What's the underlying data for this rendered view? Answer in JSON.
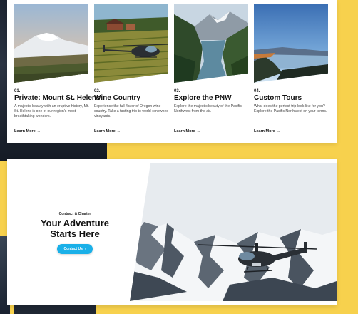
{
  "cards": [
    {
      "number": "01.",
      "title": "Private: Mount St. Helens",
      "description": "A majestic beauty with an eruptive history, Mt. St. Helens is one of our region's most breathtaking wonders.",
      "link_label": "Learn More",
      "image_icon": "mountain-image"
    },
    {
      "number": "02.",
      "title": "Wine Country",
      "description": "Experience the full flavor of Oregon wine country. Take a tasting trip to world-renowned vineyards.",
      "link_label": "Learn More",
      "image_icon": "vineyard-helicopter-image"
    },
    {
      "number": "03.",
      "title": "Explore the PNW",
      "description": "Explore the majestic beauty of the Pacific Northwest from the air.",
      "link_label": "Learn More",
      "image_icon": "river-valley-image"
    },
    {
      "number": "04.",
      "title": "Custom Tours",
      "description": "What does the perfect trip look like for you? Explore the Pacific Northwest on your terms.",
      "link_label": "Learn More",
      "image_icon": "lake-sunset-image"
    }
  ],
  "hero": {
    "eyebrow": "Contract & Charter",
    "title": "Your Adventure Starts Here",
    "button_label": "Contact Us",
    "button_icon": "chevron-right-icon",
    "image_icon": "helicopter-snowy-mountains-image"
  },
  "colors": {
    "background": "#f7d14d",
    "accent": "#1ab0e8",
    "panel": "#ffffff"
  }
}
